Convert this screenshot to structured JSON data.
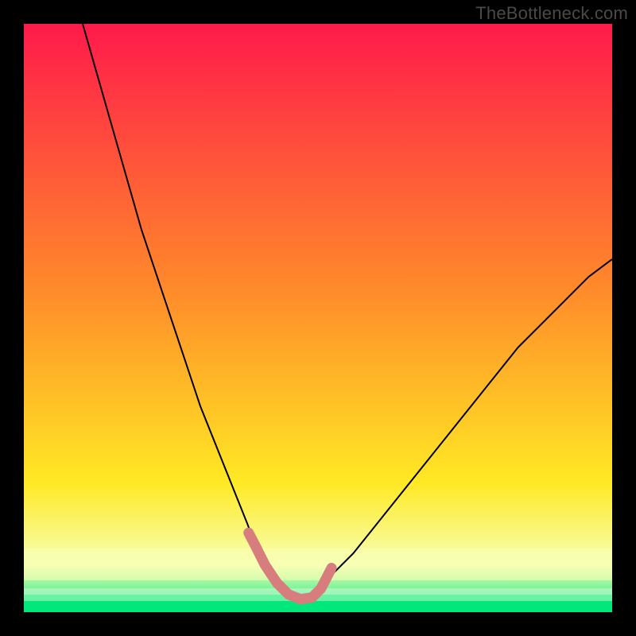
{
  "watermark": "TheBottleneck.com",
  "chart_data": {
    "type": "line",
    "title": "",
    "xlabel": "",
    "ylabel": "",
    "xlim": [
      0,
      100
    ],
    "ylim": [
      0,
      100
    ],
    "background_gradient": {
      "top": "#ff1a4b",
      "mid1": "#ff8a2a",
      "mid2": "#ffe924",
      "bottom_band": "#f7ffb5",
      "base": "#00e87b"
    },
    "series": [
      {
        "name": "bottleneck-curve",
        "color": "#000000",
        "stroke_width": 2,
        "x": [
          10,
          12,
          14,
          16,
          18,
          20,
          22,
          24,
          26,
          28,
          30,
          32,
          34,
          36,
          38,
          39.5,
          41,
          43,
          45,
          47,
          49,
          50.5,
          52,
          56,
          60,
          64,
          68,
          72,
          76,
          80,
          84,
          88,
          92,
          96,
          100
        ],
        "y": [
          100,
          93,
          86,
          79,
          72,
          65,
          59,
          53,
          47,
          41,
          35,
          30,
          25,
          20,
          15,
          11,
          8,
          5,
          3,
          2.2,
          2.5,
          4,
          6,
          10,
          15,
          20,
          25,
          30,
          35,
          40,
          45,
          49,
          53,
          57,
          60
        ]
      },
      {
        "name": "optimal-range-marker",
        "color": "#d77d7d",
        "stroke_width": 13,
        "stroke_linecap": "round",
        "x": [
          38.2,
          39.5,
          41,
          43,
          45,
          47,
          49,
          50.5,
          52.3
        ],
        "y": [
          13.5,
          11,
          8,
          5,
          3,
          2.2,
          2.5,
          4,
          7.5
        ]
      }
    ]
  }
}
